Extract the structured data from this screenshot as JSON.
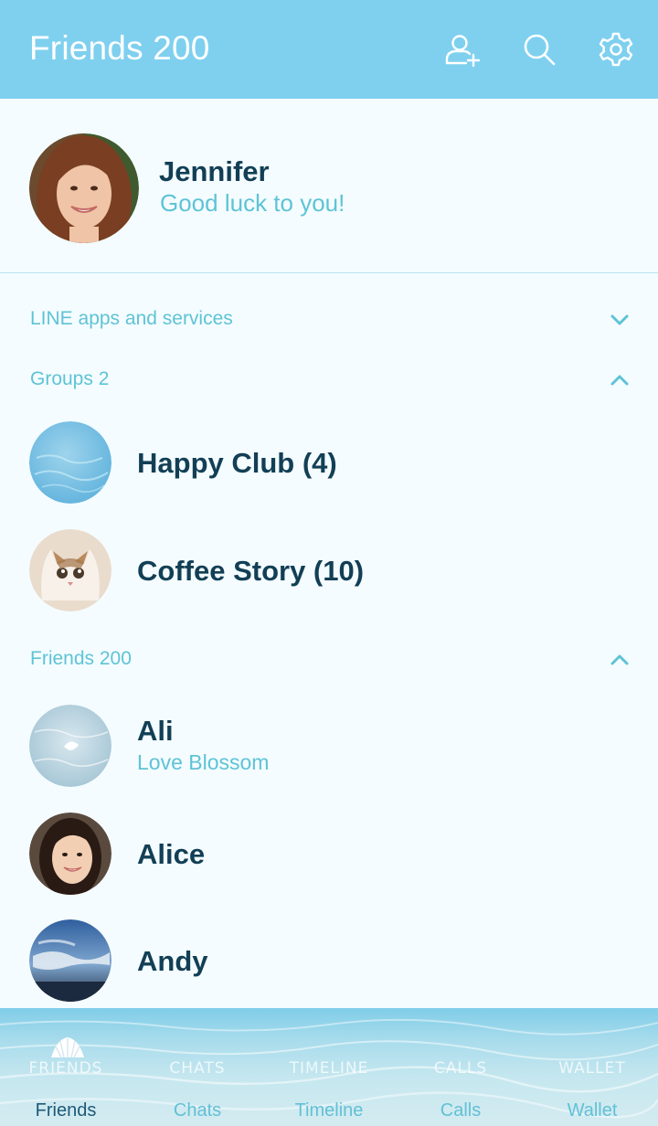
{
  "header": {
    "title": "Friends 200",
    "icons": [
      "add-friend-icon",
      "search-icon",
      "settings-gear-icon"
    ]
  },
  "profile": {
    "name": "Jennifer",
    "status": "Good luck to you!"
  },
  "sections": {
    "services": {
      "label": "LINE apps and services",
      "state": "collapsed"
    },
    "groups": {
      "label": "Groups 2",
      "state": "expanded"
    },
    "friends": {
      "label": "Friends 200",
      "state": "expanded"
    }
  },
  "groups": [
    {
      "name": "Happy Club (4)"
    },
    {
      "name": "Coffee Story (10)"
    }
  ],
  "friends": [
    {
      "name": "Ali",
      "status": "Love Blossom"
    },
    {
      "name": "Alice"
    },
    {
      "name": "Andy"
    }
  ],
  "tabs": [
    {
      "caps": "FRIENDS",
      "label": "Friends",
      "active": true
    },
    {
      "caps": "CHATS",
      "label": "Chats"
    },
    {
      "caps": "TIMELINE",
      "label": "Timeline"
    },
    {
      "caps": "CALLS",
      "label": "Calls"
    },
    {
      "caps": "WALLET",
      "label": "Wallet"
    }
  ],
  "colors": {
    "header_bg": "#7fd0ef",
    "page_bg": "#f4fcff",
    "name_text": "#123f55",
    "accent_text": "#5ec3d6"
  }
}
